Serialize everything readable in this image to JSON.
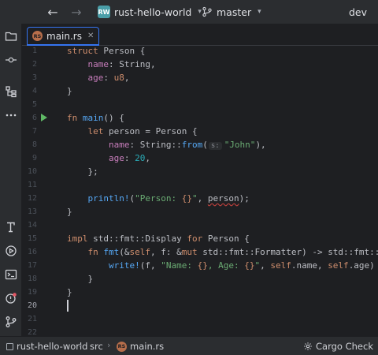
{
  "titlebar": {
    "project_badge": "RW",
    "project_name": "rust-hello-world",
    "branch": "master",
    "profile": "dev"
  },
  "tab": {
    "label": "main.rs",
    "icon_text": "RS"
  },
  "editor": {
    "lines": [
      {
        "n": "1",
        "tokens": [
          [
            "kw",
            "struct"
          ],
          [
            "",
            "&nbsp;"
          ],
          [
            "ty",
            "Person"
          ],
          [
            "",
            "&nbsp;{"
          ]
        ]
      },
      {
        "n": "2",
        "tokens": [
          [
            "",
            "&nbsp;&nbsp;&nbsp;&nbsp;"
          ],
          [
            "field",
            "name"
          ],
          [
            "",
            ": String,"
          ]
        ]
      },
      {
        "n": "3",
        "tokens": [
          [
            "",
            "&nbsp;&nbsp;&nbsp;&nbsp;"
          ],
          [
            "field",
            "age"
          ],
          [
            "",
            ": "
          ],
          [
            "kw",
            "u8"
          ],
          [
            "",
            ","
          ]
        ]
      },
      {
        "n": "4",
        "tokens": [
          [
            "",
            "}"
          ]
        ]
      },
      {
        "n": "5",
        "tokens": []
      },
      {
        "n": "6",
        "run": true,
        "tokens": [
          [
            "kw",
            "fn"
          ],
          [
            "",
            "&nbsp;"
          ],
          [
            "fn",
            "main"
          ],
          [
            "",
            "() {"
          ]
        ]
      },
      {
        "n": "7",
        "tokens": [
          [
            "",
            "&nbsp;&nbsp;&nbsp;&nbsp;"
          ],
          [
            "kw",
            "let"
          ],
          [
            "",
            "&nbsp;person = Person {"
          ]
        ]
      },
      {
        "n": "8",
        "tokens": [
          [
            "",
            "&nbsp;&nbsp;&nbsp;&nbsp;&nbsp;&nbsp;&nbsp;&nbsp;"
          ],
          [
            "field",
            "name"
          ],
          [
            "",
            ": String::"
          ],
          [
            "fn",
            "from"
          ],
          [
            "",
            "("
          ],
          [
            "hint",
            "s:"
          ],
          [
            "str",
            "\"John\""
          ],
          [
            "",
            "),"
          ]
        ]
      },
      {
        "n": "9",
        "tokens": [
          [
            "",
            "&nbsp;&nbsp;&nbsp;&nbsp;&nbsp;&nbsp;&nbsp;&nbsp;"
          ],
          [
            "field",
            "age"
          ],
          [
            "",
            ": "
          ],
          [
            "num",
            "20"
          ],
          [
            "",
            ","
          ]
        ]
      },
      {
        "n": "10",
        "tokens": [
          [
            "",
            "&nbsp;&nbsp;&nbsp;&nbsp;};"
          ]
        ]
      },
      {
        "n": "11",
        "tokens": []
      },
      {
        "n": "12",
        "tokens": [
          [
            "",
            "&nbsp;&nbsp;&nbsp;&nbsp;"
          ],
          [
            "mac",
            "println!"
          ],
          [
            "",
            "("
          ],
          [
            "str",
            "\"Person: "
          ],
          [
            "fmt",
            "{}"
          ],
          [
            "str",
            "\""
          ],
          [
            "",
            ", "
          ],
          [
            "typo",
            "person"
          ],
          [
            "",
            ");"
          ]
        ]
      },
      {
        "n": "13",
        "tokens": [
          [
            "",
            "}"
          ]
        ]
      },
      {
        "n": "14",
        "tokens": []
      },
      {
        "n": "15",
        "tokens": [
          [
            "kw",
            "impl"
          ],
          [
            "",
            "&nbsp;std::fmt::Display "
          ],
          [
            "kw",
            "for"
          ],
          [
            "",
            "&nbsp;Person {"
          ]
        ]
      },
      {
        "n": "16",
        "tokens": [
          [
            "",
            "&nbsp;&nbsp;&nbsp;&nbsp;"
          ],
          [
            "kw",
            "fn"
          ],
          [
            "",
            "&nbsp;"
          ],
          [
            "fn",
            "fmt"
          ],
          [
            "",
            "(&"
          ],
          [
            "kw",
            "self"
          ],
          [
            "",
            ", f: &"
          ],
          [
            "kw",
            "mut"
          ],
          [
            "",
            "&nbsp;std::fmt::Formatter) -> std::fmt::Result"
          ]
        ]
      },
      {
        "n": "17",
        "tokens": [
          [
            "",
            "&nbsp;&nbsp;&nbsp;&nbsp;&nbsp;&nbsp;&nbsp;&nbsp;"
          ],
          [
            "mac",
            "write!"
          ],
          [
            "",
            "(f, "
          ],
          [
            "str",
            "\"Name: "
          ],
          [
            "fmt",
            "{}"
          ],
          [
            "str",
            ", Age: "
          ],
          [
            "fmt",
            "{}"
          ],
          [
            "str",
            "\""
          ],
          [
            "",
            ", "
          ],
          [
            "kw",
            "self"
          ],
          [
            "",
            ".name, "
          ],
          [
            "kw",
            "self"
          ],
          [
            "",
            ".age)"
          ]
        ]
      },
      {
        "n": "18",
        "tokens": [
          [
            "",
            "&nbsp;&nbsp;&nbsp;&nbsp;}"
          ]
        ]
      },
      {
        "n": "19",
        "tokens": [
          [
            "",
            "}"
          ]
        ]
      },
      {
        "n": "20",
        "active": true,
        "cursor": true,
        "tokens": []
      },
      {
        "n": "21",
        "tokens": []
      },
      {
        "n": "22",
        "tokens": []
      }
    ]
  },
  "statusbar": {
    "project": "rust-hello-world",
    "folder": "src",
    "file": "main.rs",
    "widget": "Cargo Check"
  },
  "icons": {
    "left": [
      "folder-icon",
      "commit-icon",
      "structure-icon",
      "more-icon",
      "terminal-icon",
      "services-icon",
      "console-icon",
      "problems-icon",
      "git-icon"
    ]
  }
}
